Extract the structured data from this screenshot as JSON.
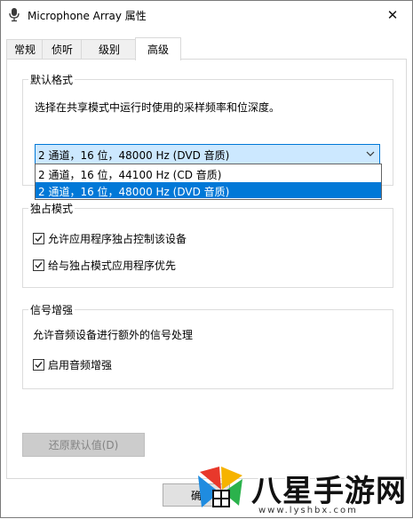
{
  "window": {
    "title": "Microphone Array 属性",
    "close_glyph": "✕"
  },
  "tabs": [
    {
      "label": "常规"
    },
    {
      "label": "侦听"
    },
    {
      "label": "级别"
    },
    {
      "label": "高级"
    }
  ],
  "default_format": {
    "group_label": "默认格式",
    "description": "选择在共享模式中运行时使用的采样频率和位深度。",
    "selected_value": "2 通道，16 位，48000 Hz (DVD 音质)",
    "options": [
      "2 通道，16 位，44100 Hz (CD 音质)",
      "2 通道，16 位，48000 Hz (DVD 音质)"
    ]
  },
  "exclusive_mode": {
    "group_label": "独占模式",
    "checkboxes": [
      {
        "label": "允许应用程序独占控制该设备",
        "checked": true
      },
      {
        "label": "给与独占模式应用程序优先",
        "checked": true
      }
    ]
  },
  "signal_enhancement": {
    "group_label": "信号增强",
    "description": "允许音频设备进行额外的信号处理",
    "checkbox": {
      "label": "启用音频增强",
      "checked": true
    }
  },
  "buttons": {
    "restore_defaults": "还原默认值(D)",
    "bottom_partial": "确"
  },
  "watermark": {
    "text": "八星手游网",
    "sub": "www.lyshbx.com"
  },
  "colors": {
    "accent": "#0078d7",
    "combo_bg": "#cce8ff",
    "disabled_btn": "#cccccc"
  }
}
